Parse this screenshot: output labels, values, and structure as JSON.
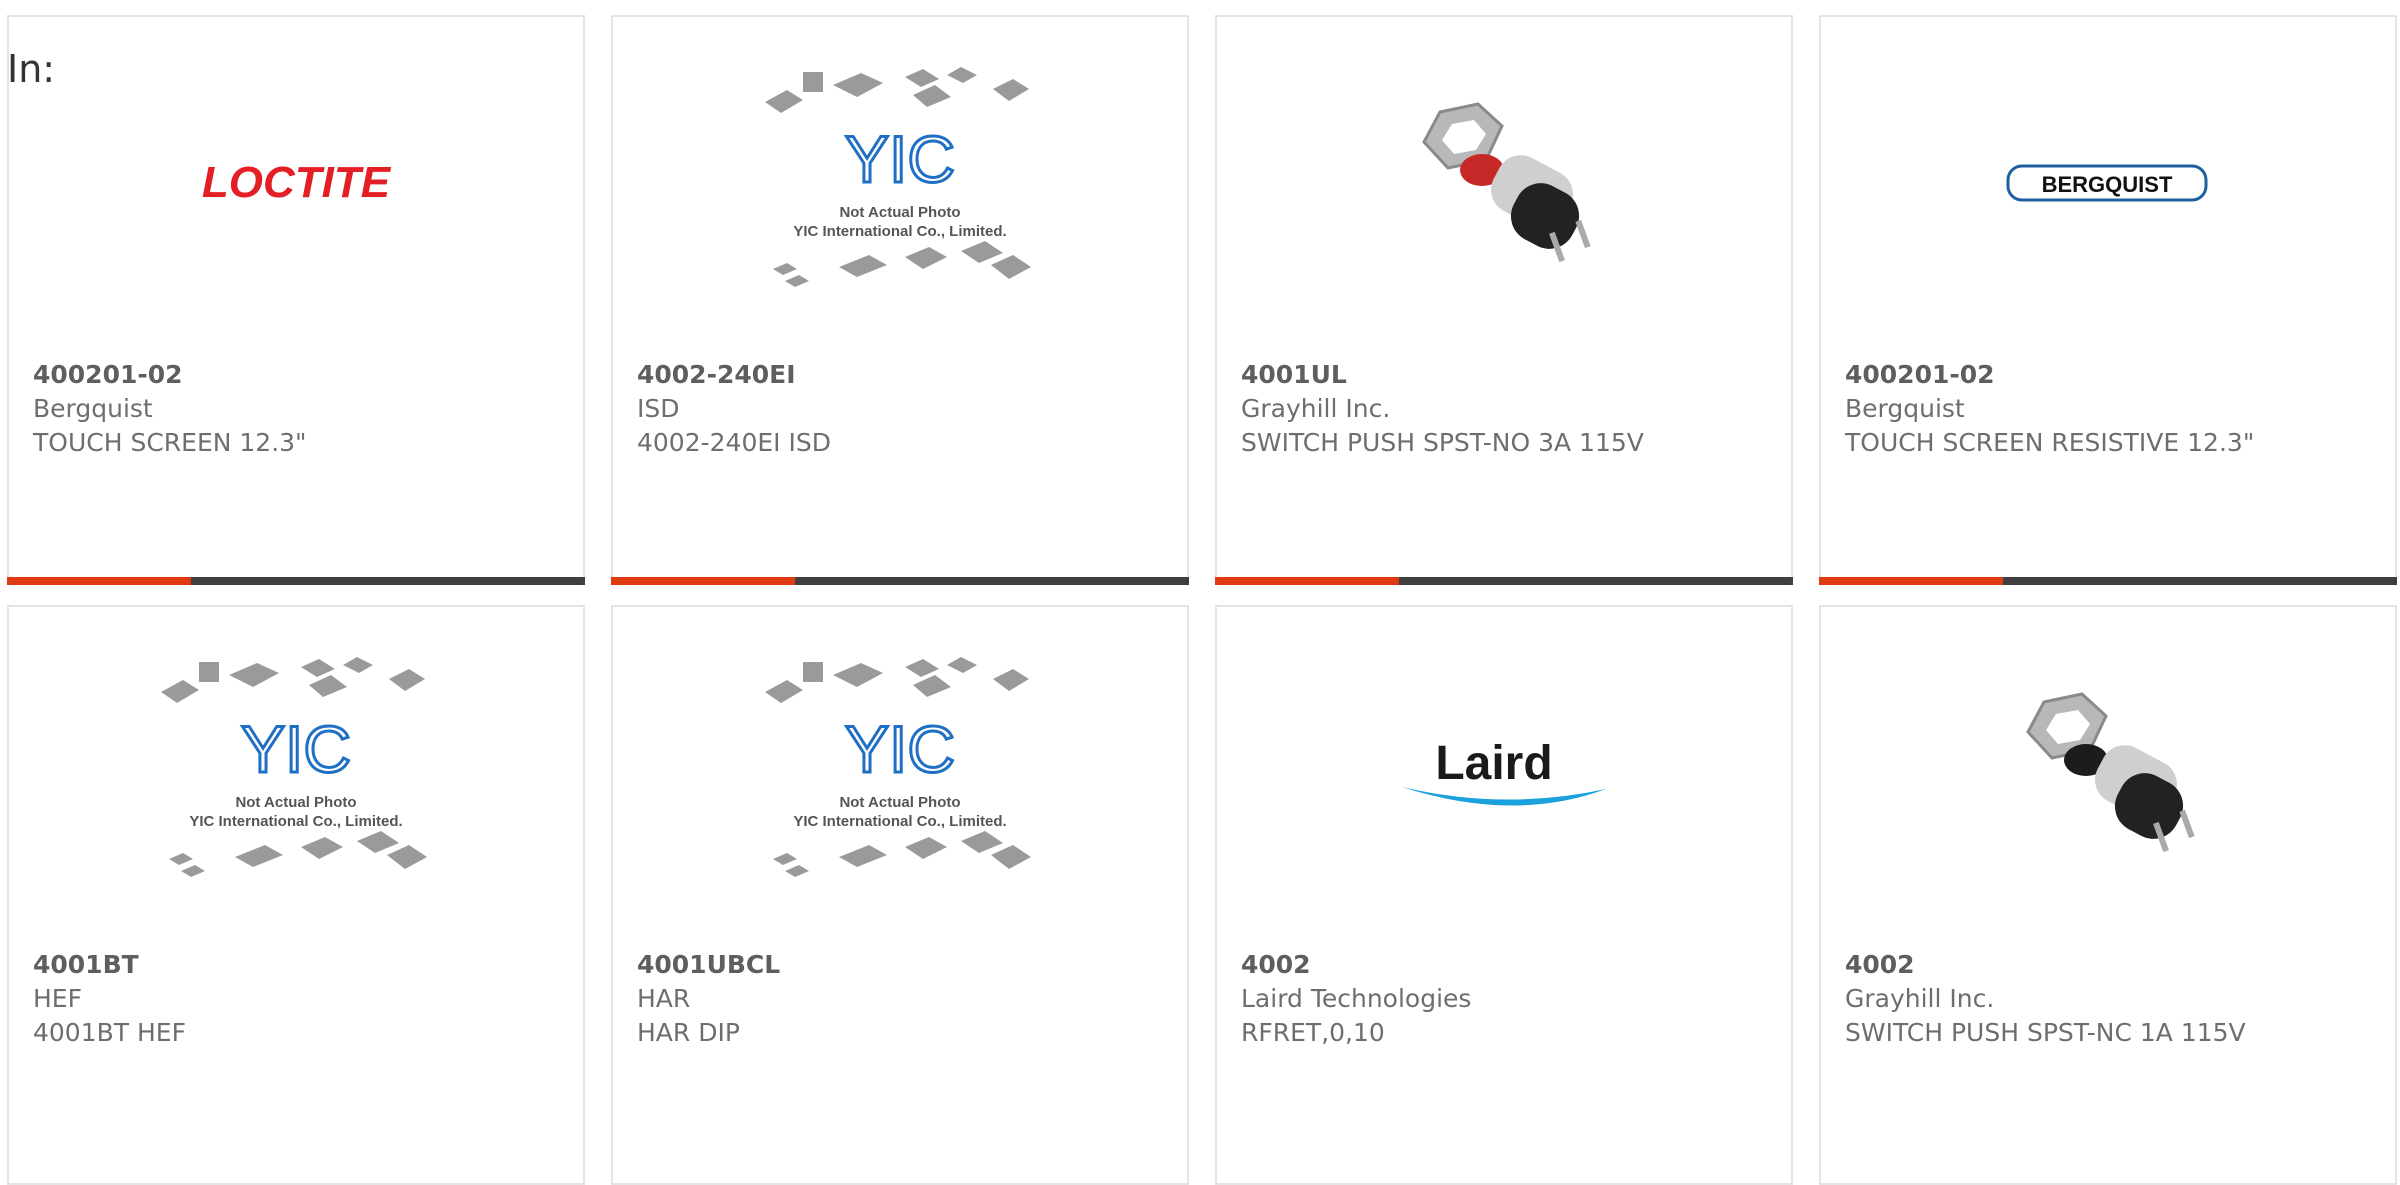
{
  "header": {
    "in_label": "In:"
  },
  "brand_logos": {
    "loctite": "LOCTITE",
    "bergquist": "BERGQUIST",
    "laird": "Laird",
    "yic_mark": "YIC",
    "yic_line1": "Not Actual Photo",
    "yic_line2": "YIC International Co., Limited."
  },
  "products": [
    {
      "part": "400201-02",
      "manufacturer": "Bergquist",
      "description": "TOUCH SCREEN 12.3\"",
      "image": "loctite-logo"
    },
    {
      "part": "4002-240EI",
      "manufacturer": "ISD",
      "description": "4002-240EI ISD",
      "image": "yic-placeholder"
    },
    {
      "part": "4001UL",
      "manufacturer": "Grayhill Inc.",
      "description": "SWITCH PUSH SPST-NO 3A 115V",
      "image": "pushbutton-red"
    },
    {
      "part": "400201-02",
      "manufacturer": "Bergquist",
      "description": "TOUCH SCREEN RESISTIVE 12.3\"",
      "image": "bergquist-logo"
    },
    {
      "part": "4001BT",
      "manufacturer": "HEF",
      "description": "4001BT HEF",
      "image": "yic-placeholder"
    },
    {
      "part": "4001UBCL",
      "manufacturer": "HAR",
      "description": "HAR DIP",
      "image": "yic-placeholder"
    },
    {
      "part": "4002",
      "manufacturer": "Laird Technologies",
      "description": "RFRET,0,10",
      "image": "laird-logo"
    },
    {
      "part": "4002",
      "manufacturer": "Grayhill Inc.",
      "description": "SWITCH PUSH SPST-NC 1A 115V",
      "image": "pushbutton-black"
    }
  ],
  "colors": {
    "accent": "#e03a10",
    "bar": "#3f3f3f",
    "loctite_red": "#e31e24",
    "yic_blue": "#1f6fc4",
    "laird_blue": "#1ba1dc"
  }
}
